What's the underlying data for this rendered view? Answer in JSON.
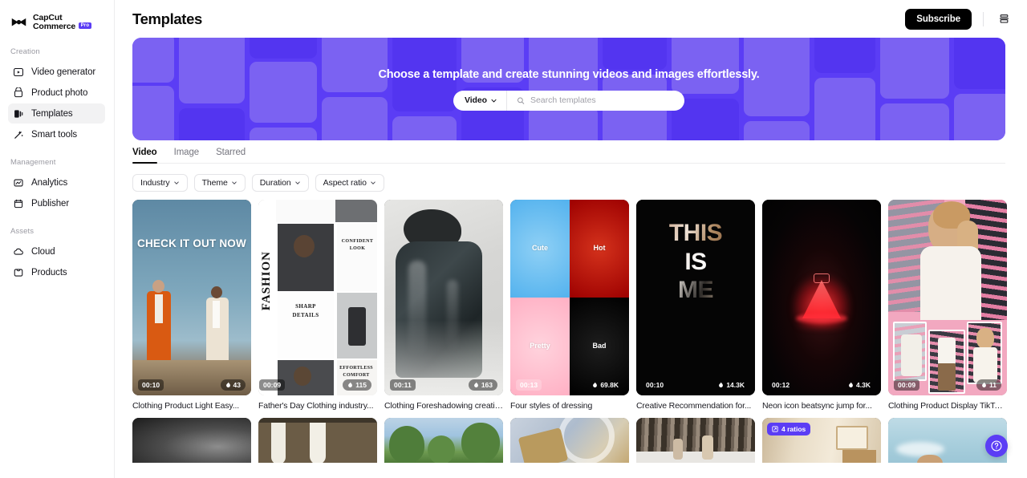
{
  "brand": {
    "line1": "CapCut",
    "line2": "Commerce",
    "badge": "Pro",
    "logo_icon": "capcut-logo-icon"
  },
  "sidebar": {
    "groups": [
      {
        "label": "Creation",
        "items": [
          {
            "label": "Video generator",
            "icon": "video-generator-icon",
            "active": false
          },
          {
            "label": "Product photo",
            "icon": "product-photo-icon",
            "active": false
          },
          {
            "label": "Templates",
            "icon": "templates-icon",
            "active": true
          },
          {
            "label": "Smart tools",
            "icon": "smart-tools-icon",
            "active": false
          }
        ]
      },
      {
        "label": "Management",
        "items": [
          {
            "label": "Analytics",
            "icon": "analytics-icon",
            "active": false
          },
          {
            "label": "Publisher",
            "icon": "publisher-icon",
            "active": false
          }
        ]
      },
      {
        "label": "Assets",
        "items": [
          {
            "label": "Cloud",
            "icon": "cloud-icon",
            "active": false
          },
          {
            "label": "Products",
            "icon": "products-icon",
            "active": false
          }
        ]
      }
    ]
  },
  "topbar": {
    "title": "Templates",
    "subscribe_label": "Subscribe",
    "menu_icon": "stack-menu-icon"
  },
  "hero": {
    "title": "Choose a template and create stunning videos and images effortlessly.",
    "background_color": "#5b3df5",
    "search": {
      "type_label": "Video",
      "type_chevron_icon": "chevron-down-icon",
      "search_icon": "search-icon",
      "placeholder": "Search templates",
      "value": ""
    }
  },
  "tabs": [
    {
      "label": "Video",
      "active": true
    },
    {
      "label": "Image",
      "active": false
    },
    {
      "label": "Starred",
      "active": false
    }
  ],
  "filters": [
    {
      "label": "Industry",
      "icon": "chevron-down-icon"
    },
    {
      "label": "Theme",
      "icon": "chevron-down-icon"
    },
    {
      "label": "Duration",
      "icon": "chevron-down-icon"
    },
    {
      "label": "Aspect ratio",
      "icon": "chevron-down-icon"
    }
  ],
  "grid": {
    "row1": [
      {
        "title": "Clothing Product Light Easy...",
        "duration": "00:10",
        "likes": "43",
        "art": "two-models-sky",
        "overlay_text": "CHECK IT OUT NOW"
      },
      {
        "title": "Father's Day Clothing industry...",
        "duration": "00:09",
        "likes": "115",
        "art": "fashion-collage",
        "overlay_text": "FASHION"
      },
      {
        "title": "Clothing Foreshadowing creativ...",
        "duration": "00:11",
        "likes": "163",
        "art": "leather-coat-smoke",
        "overlay_text": ""
      },
      {
        "title": "Four styles of dressing",
        "duration": "00:13",
        "likes": "69.8K",
        "art": "four-quadrant",
        "quadrants": [
          "Cute",
          "Hot",
          "Pretty",
          "Bad"
        ]
      },
      {
        "title": "Creative Recommendation for...",
        "duration": "00:10",
        "likes": "14.3K",
        "art": "this-is-me-text",
        "overlay_text": "THIS IS ME"
      },
      {
        "title": "Neon icon beatsync jump for...",
        "duration": "00:12",
        "likes": "4.3K",
        "art": "neon-dress",
        "overlay_text": ""
      },
      {
        "title": "Clothing Product Display TikTok...",
        "duration": "00:09",
        "likes": "11",
        "art": "pink-wall-model",
        "overlay_text": ""
      }
    ],
    "row2": [
      {
        "art": "dark-gradient",
        "badge": ""
      },
      {
        "art": "dresses-rack",
        "badge": ""
      },
      {
        "art": "green-trees",
        "badge": ""
      },
      {
        "art": "blue-abstract",
        "badge": ""
      },
      {
        "art": "snow-forest",
        "badge": ""
      },
      {
        "art": "interior-shelf",
        "badge": "4 ratios",
        "badge_icon": "ratio-icon"
      },
      {
        "art": "sky-portrait",
        "badge": ""
      }
    ]
  },
  "help": {
    "icon": "question-mark-icon",
    "label": "Help"
  },
  "colors": {
    "accent": "#5b3df5",
    "hero_bg": "#5b3df5",
    "text_primary": "#0b0b0b",
    "text_muted": "#75757e"
  }
}
